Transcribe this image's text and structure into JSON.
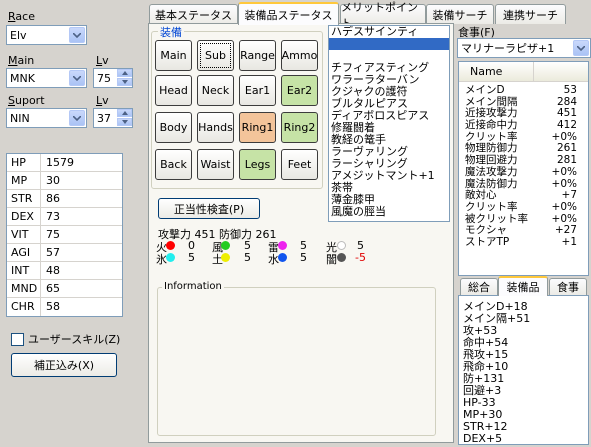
{
  "left": {
    "race_label": "Race",
    "race_value": "Elv",
    "main_label": "Main",
    "main_value": "MNK",
    "lv_label": "Lv",
    "main_lv": "75",
    "support_label": "Suport",
    "support_value": "NIN",
    "support_lv_label": "Lv",
    "support_lv": "37",
    "stats": [
      {
        "k": "HP",
        "v": "1579"
      },
      {
        "k": "MP",
        "v": "30"
      },
      {
        "k": "STR",
        "v": "86"
      },
      {
        "k": "DEX",
        "v": "73"
      },
      {
        "k": "VIT",
        "v": "75"
      },
      {
        "k": "AGI",
        "v": "57"
      },
      {
        "k": "INT",
        "v": "48"
      },
      {
        "k": "MND",
        "v": "65"
      },
      {
        "k": "CHR",
        "v": "58"
      }
    ],
    "user_skill_label": "ユーザースキル(Z)",
    "correction_button": "補正込み(X)"
  },
  "tabs": [
    "基本ステータス",
    "装備品ステータス",
    "メリットポイント",
    "装備サーチ",
    "連携サーチ"
  ],
  "equip": {
    "group_title": "装備",
    "slots": [
      "Main",
      "Sub",
      "Range",
      "Ammo",
      "Head",
      "Neck",
      "Ear1",
      "Ear2",
      "Body",
      "Hands",
      "Ring1",
      "Ring2",
      "Back",
      "Waist",
      "Legs",
      "Feet"
    ],
    "validity_button": "正当性検査(P)",
    "items": [
      "ハデスサインティ",
      "",
      "",
      "チフィアスティング",
      "ワラーラターバン",
      "クジャクの護符",
      "ブルタルピアス",
      "ディアボロスピアス",
      "修羅闘着",
      "教経の篭手",
      "ラーヴァリング",
      "ラーシャリング",
      "アメジットマント+1",
      "茶帯",
      "薄金膝甲",
      "風魔の脛当"
    ],
    "atk_label": "攻撃力",
    "atk_value": "451",
    "def_label": "防御力",
    "def_value": "261",
    "elements_row1": [
      {
        "name": "火",
        "value": "0",
        "color": "#ff0000"
      },
      {
        "name": "風",
        "value": "5",
        "color": "#22cc22"
      },
      {
        "name": "雷",
        "value": "5",
        "color": "#ee22ee"
      },
      {
        "name": "光",
        "value": "5",
        "color": "#ffffff"
      }
    ],
    "elements_row2": [
      {
        "name": "氷",
        "value": "5",
        "color": "#22eeee"
      },
      {
        "name": "土",
        "value": "5",
        "color": "#eeee00"
      },
      {
        "name": "水",
        "value": "5",
        "color": "#1155ee"
      },
      {
        "name": "闇",
        "value": "-5",
        "color": "#555555"
      }
    ],
    "info_title": "Information"
  },
  "right": {
    "food_label": "食事(F)",
    "food_value": "マリナーラピザ+1",
    "col_name": "Name",
    "rows": [
      {
        "n": "メインD",
        "v": "53"
      },
      {
        "n": "メイン間隔",
        "v": "284"
      },
      {
        "n": "近接攻撃力",
        "v": "451"
      },
      {
        "n": "近接命中力",
        "v": "412"
      },
      {
        "n": "クリット率",
        "v": "+0%"
      },
      {
        "n": "物理防御力",
        "v": "261"
      },
      {
        "n": "物理回避力",
        "v": "281"
      },
      {
        "n": "魔法攻撃力",
        "v": "+0%"
      },
      {
        "n": "魔法防御力",
        "v": "+0%"
      },
      {
        "n": "敵対心",
        "v": "+7"
      },
      {
        "n": "クリット率",
        "v": "+0%"
      },
      {
        "n": "被クリット率",
        "v": "+0%"
      },
      {
        "n": "モクシャ",
        "v": "+27"
      },
      {
        "n": "ストアTP",
        "v": "+1"
      }
    ],
    "subtabs": [
      "総合",
      "装備品",
      "食事"
    ],
    "effects": [
      "メインD+18",
      "メイン隔+51",
      "攻+53",
      "命中+54",
      "飛攻+15",
      "飛命+10",
      "防+131",
      "回避+3",
      "HP-33",
      "MP+30",
      "STR+12",
      "DEX+5"
    ]
  }
}
